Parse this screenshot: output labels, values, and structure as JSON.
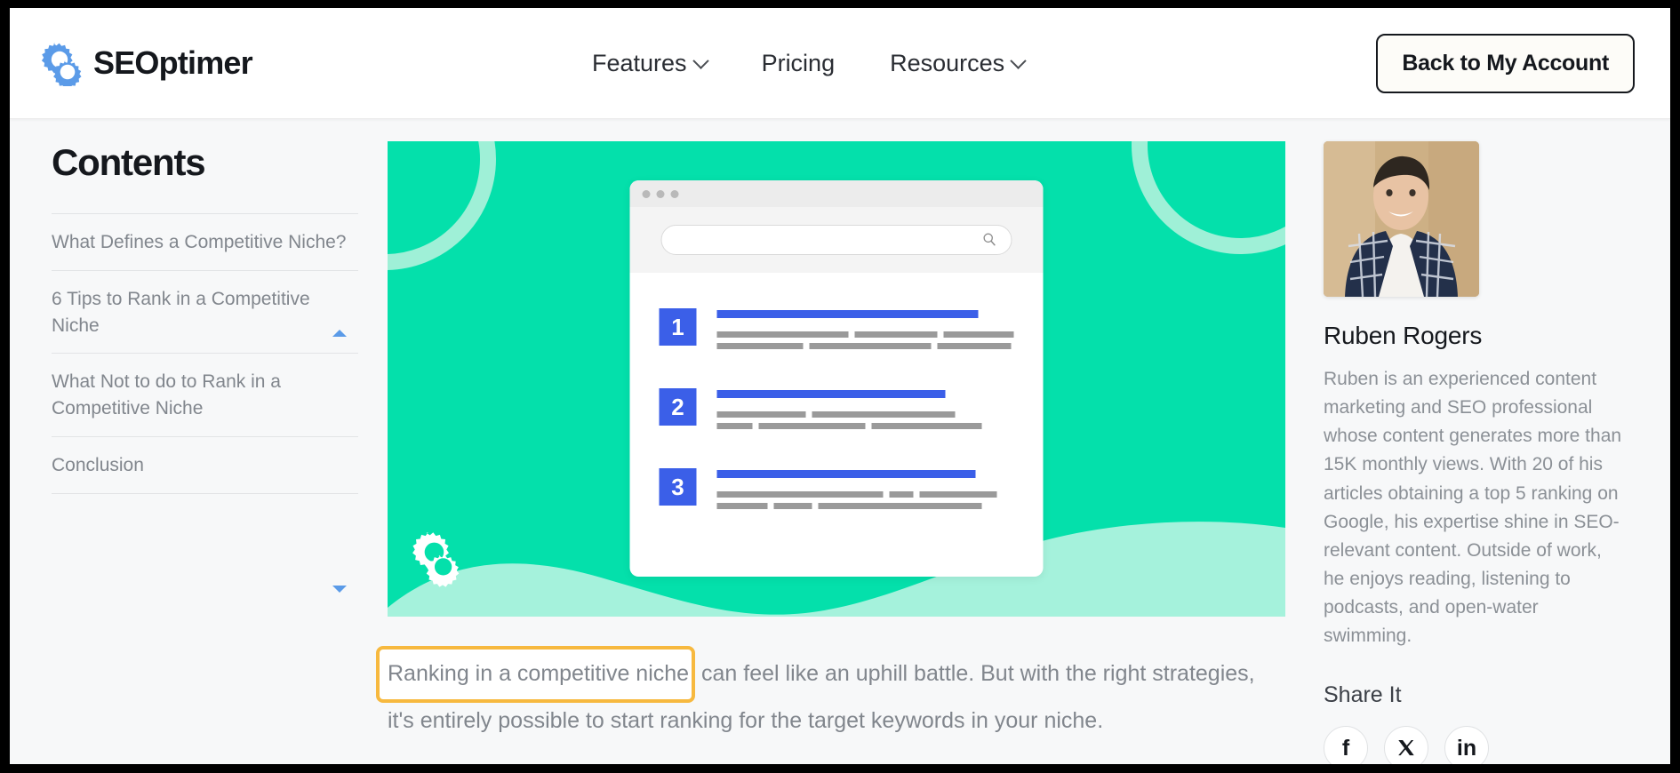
{
  "header": {
    "brand_name": "SEOptimer",
    "logo_icon": "seoptimer-gear-logo",
    "nav": [
      {
        "label": "Features",
        "has_dropdown": true,
        "icon": "chevron-down-icon"
      },
      {
        "label": "Pricing",
        "has_dropdown": false,
        "icon": ""
      },
      {
        "label": "Resources",
        "has_dropdown": true,
        "icon": "chevron-down-icon"
      }
    ],
    "account_button": "Back to My Account"
  },
  "sidebar": {
    "title": "Contents",
    "items": [
      {
        "label": "What Defines a Competitive Niche?"
      },
      {
        "label": "6 Tips to Rank in a Competitive Niche"
      },
      {
        "label": "What Not to do to Rank in a Competitive Niche"
      },
      {
        "label": "Conclusion"
      }
    ],
    "scroll_up_icon": "triangle-up-icon",
    "scroll_down_icon": "triangle-down-icon"
  },
  "hero": {
    "alt": "serp-ranking-illustration",
    "background_color": "#04e0ab",
    "wave_color": "#a5f2dc",
    "arc_color": "#9ff0d7",
    "accent_color": "#3b5fe8",
    "gear_icon": "seoptimer-gear-icon",
    "browser": {
      "search_icon": "search-icon",
      "search_value": "",
      "results": [
        {
          "rank": "1"
        },
        {
          "rank": "2"
        },
        {
          "rank": "3"
        }
      ]
    }
  },
  "article": {
    "highlighted_text": "Ranking in a competitive niche",
    "highlight_color": "#f7b93f",
    "paragraph_rest": " can feel like an uphill battle. But with the right strategies, it's entirely possible to start ranking for the target keywords in your niche."
  },
  "author": {
    "avatar_alt": "author-portrait-ruben-rogers",
    "name": "Ruben Rogers",
    "bio": "Ruben is an experienced content marketing and SEO professional whose content generates more than 15K monthly views. With 20 of his articles obtaining a top 5 ranking on Google, his expertise shine in SEO-relevant content. Outside of work, he enjoys reading, listening to podcasts, and open-water swimming.",
    "share_title": "Share It",
    "share_buttons": [
      {
        "label": "f",
        "icon": "facebook-icon"
      },
      {
        "label": "✕",
        "icon": "x-twitter-icon"
      },
      {
        "label": "in",
        "icon": "linkedin-icon"
      }
    ]
  }
}
